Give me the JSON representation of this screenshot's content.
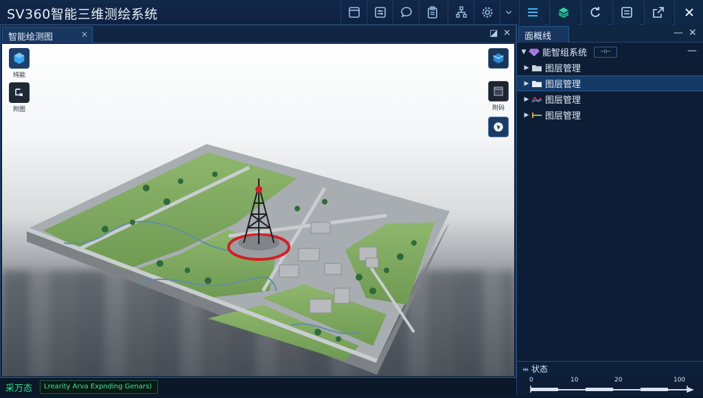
{
  "app": {
    "title": "SV360智能三维测绘系统"
  },
  "toolbar": {
    "left_icons": [
      "layout-icon",
      "sliders-icon",
      "chat-icon",
      "clipboard-icon",
      "network-icon",
      "settings-icon",
      "chevron-down-icon"
    ],
    "right_icons": [
      "menu-icon",
      "layers-icon",
      "refresh-icon",
      "list-icon",
      "export-icon",
      "close-icon"
    ]
  },
  "map_panel": {
    "tab_label": "智能绘测图",
    "tab_close": "×",
    "restore": "◪",
    "close": "✕",
    "tools_left": [
      {
        "label": "纯能"
      },
      {
        "label": "附图"
      }
    ],
    "tools_right": [
      {
        "label": ""
      },
      {
        "label": "附码"
      },
      {
        "label": ""
      }
    ]
  },
  "right_panel": {
    "tab_label": "面概线",
    "minimize": "—",
    "close": "✕",
    "tree": {
      "root": {
        "label": "能智组系统",
        "toggle": "⊣⊢"
      },
      "items": [
        {
          "label": "图层管理",
          "icon": "folder-icon",
          "selected": false
        },
        {
          "label": "图层管理",
          "icon": "folder-icon",
          "selected": true
        },
        {
          "label": "图层管理",
          "icon": "line-style-icon",
          "selected": false
        },
        {
          "label": "图层管理",
          "icon": "polyline-icon",
          "selected": false
        }
      ],
      "minus": "—"
    },
    "status": {
      "title": "状态",
      "icon": "scale-icon",
      "scale_ticks": [
        "0",
        "10",
        "20",
        "100"
      ]
    }
  },
  "statusbar": {
    "label": "采万态",
    "field_text": "Lrearity Arva Expnding Genars)"
  },
  "colors": {
    "accent": "#2ed39a",
    "frame": "#0c1d35",
    "tower_red": "#d21f25"
  }
}
